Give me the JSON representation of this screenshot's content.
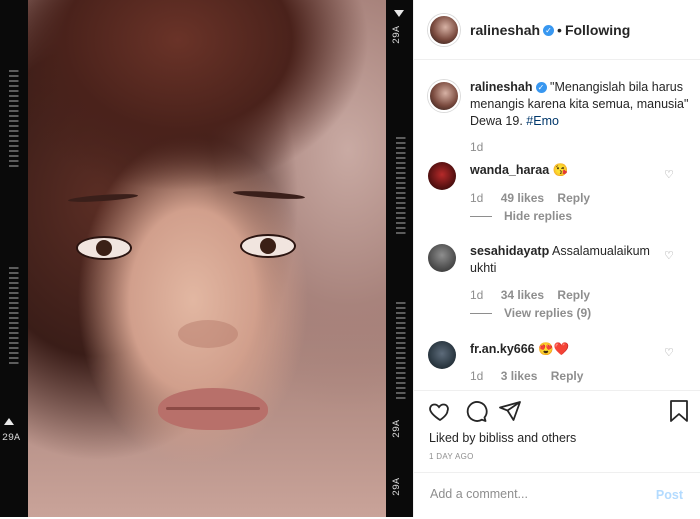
{
  "media": {
    "film_label_top": "29A",
    "film_label_mid": "29A",
    "film_label_bottom": "29A",
    "film_label_right_bottom": "29A",
    "film_ticks": "||||||||||||||||||||"
  },
  "header": {
    "username": "ralineshah",
    "separator": "•",
    "follow_state": "Following"
  },
  "caption": {
    "username": "ralineshah",
    "text": "\"Menangislah bila harus menangis karena kita semua, manusia\" Dewa 19.",
    "hashtag": "#Emo",
    "age": "1d"
  },
  "comments": [
    {
      "username": "wanda_haraa",
      "text": "😘",
      "age": "1d",
      "likes": "49 likes",
      "reply": "Reply",
      "replies_toggle": "Hide replies"
    },
    {
      "username": "sesahidayatp",
      "text": "Assalamualaikum ukhti",
      "age": "1d",
      "likes": "34 likes",
      "reply": "Reply",
      "replies_toggle": "View replies (9)"
    },
    {
      "username": "fr.an.ky666",
      "text": "😍❤️",
      "age": "1d",
      "likes": "3 likes",
      "reply": "Reply"
    }
  ],
  "actions": {
    "liked_by": "Liked by bibliss and others",
    "timestamp": "1 DAY AGO"
  },
  "add_comment": {
    "placeholder": "Add a comment...",
    "post_label": "Post"
  },
  "colors": {
    "verified": "#3897f0",
    "hashtag": "#00376b",
    "post_disabled": "#b3dbff",
    "heart_red": "#ed4956"
  }
}
